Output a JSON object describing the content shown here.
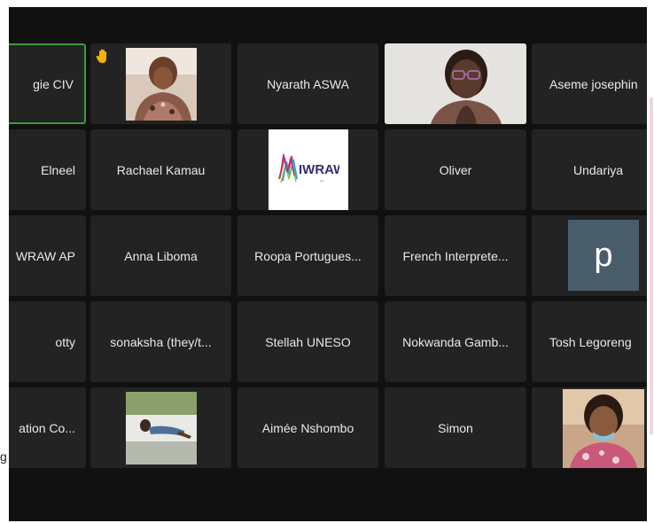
{
  "participants": {
    "p_r1c1": "gie CIV",
    "p_r1c3": "Nyarath ASWA",
    "p_r1c5": "Aseme josephin",
    "p_r2c1": "Elneel",
    "p_r2c2": "Rachael Kamau",
    "p_r2c3_logo": "IWRAW",
    "p_r2c4": "Oliver",
    "p_r2c5": "Undariya",
    "p_r3c1": "WRAW AP",
    "p_r3c2": "Anna Liboma",
    "p_r3c3": "Roopa Portugues...",
    "p_r3c4": "French Interprete...",
    "p_r3c5_avatar": "p",
    "p_r4c1": "otty",
    "p_r4c2": "sonaksha (they/t...",
    "p_r4c3": "Stellah UNESO",
    "p_r4c4": "Nokwanda Gamb...",
    "p_r4c5": "Tosh Legoreng",
    "p_r5c1": "ation Co...",
    "p_r5c3": "Aimée Nshombo",
    "p_r5c4": "Simon"
  },
  "stray_glyph": "g",
  "colors": {
    "tile_bg": "#232323",
    "active_border": "#3d9a3d",
    "raised_hand": "#f5b400"
  }
}
